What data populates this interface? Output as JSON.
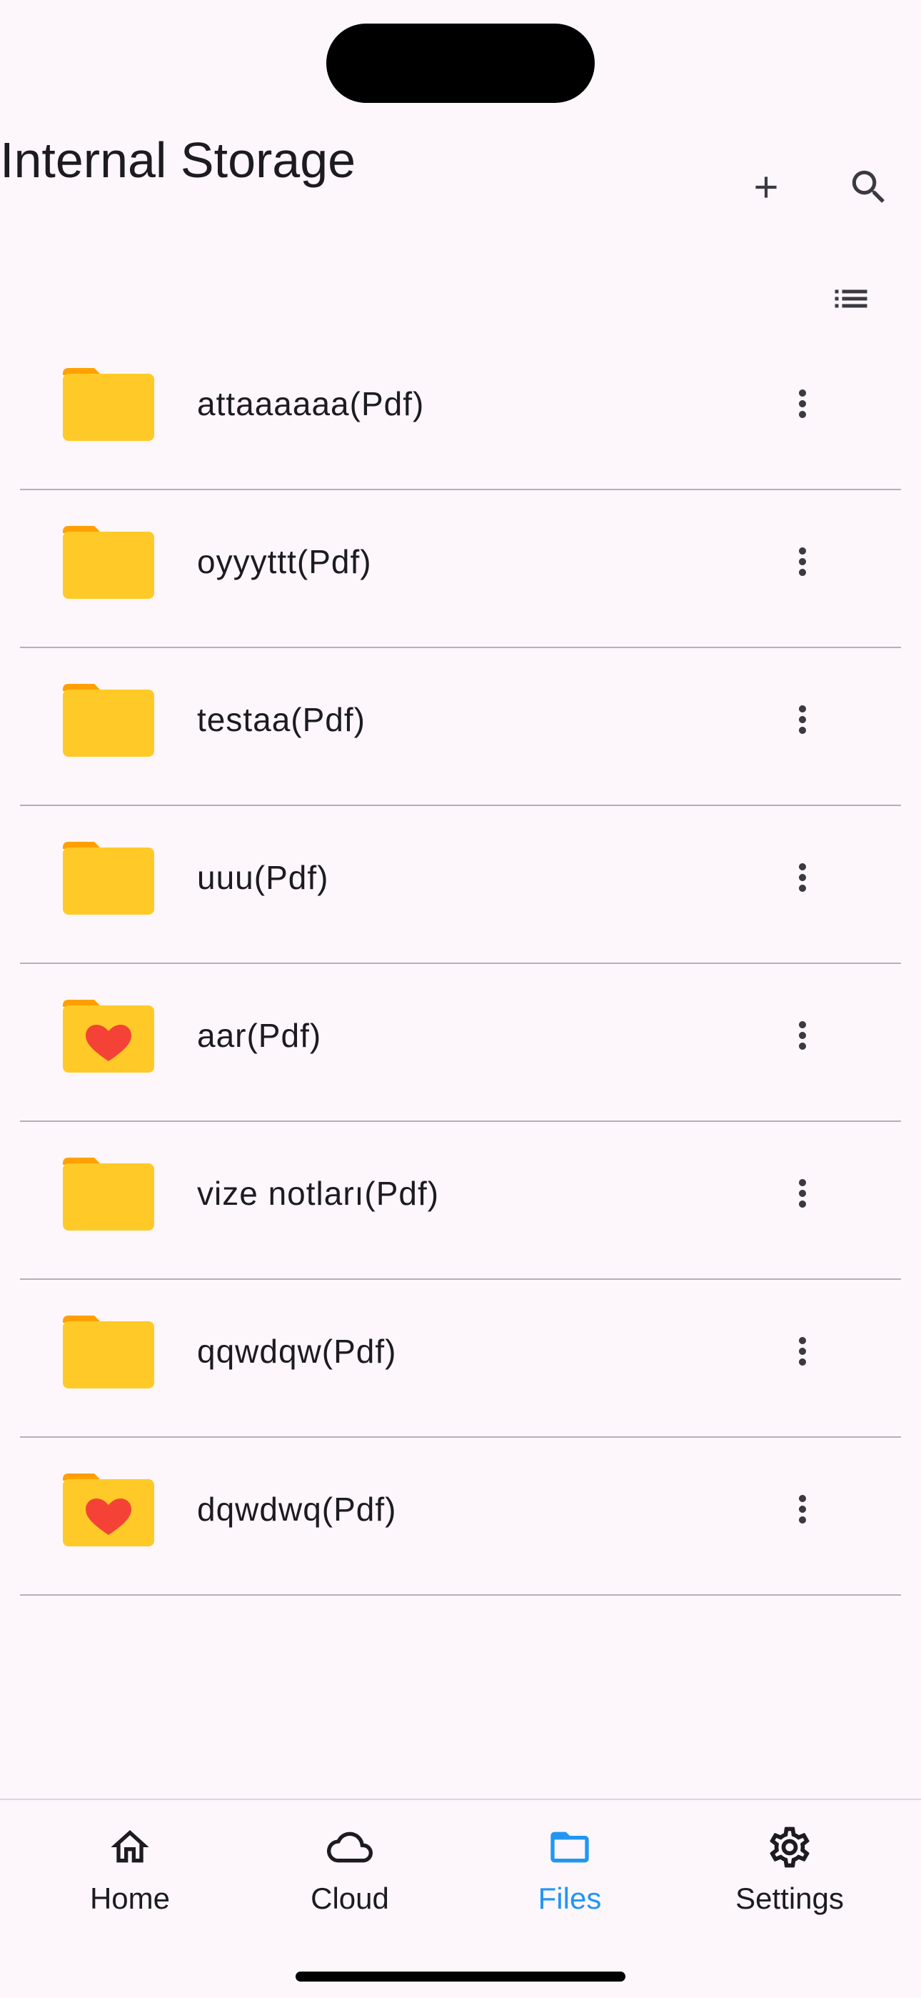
{
  "header": {
    "title": "Internal Storage",
    "add_icon": "plus-icon",
    "search_icon": "search-icon",
    "view_toggle_icon": "list-view-icon"
  },
  "colors": {
    "background": "#fdf7fc",
    "folder_body": "#ffca28",
    "folder_tab": "#ffa000",
    "heart": "#f44336",
    "accent": "#2196f3",
    "text": "#1d1b20"
  },
  "files": [
    {
      "name": "attaaaaaa(Pdf)",
      "favorite": false
    },
    {
      "name": "oyyyttt(Pdf)",
      "favorite": false
    },
    {
      "name": "testaa(Pdf)",
      "favorite": false
    },
    {
      "name": "uuu(Pdf)",
      "favorite": false
    },
    {
      "name": "aar(Pdf)",
      "favorite": true
    },
    {
      "name": "vize notları(Pdf)",
      "favorite": false
    },
    {
      "name": "qqwdqw(Pdf)",
      "favorite": false
    },
    {
      "name": "dqwdwq(Pdf)",
      "favorite": true
    }
  ],
  "bottom_nav": {
    "items": [
      {
        "label": "Home",
        "icon": "home-icon"
      },
      {
        "label": "Cloud",
        "icon": "cloud-icon"
      },
      {
        "label": "Files",
        "icon": "folder-icon",
        "active": true
      },
      {
        "label": "Settings",
        "icon": "gear-icon"
      }
    ]
  }
}
